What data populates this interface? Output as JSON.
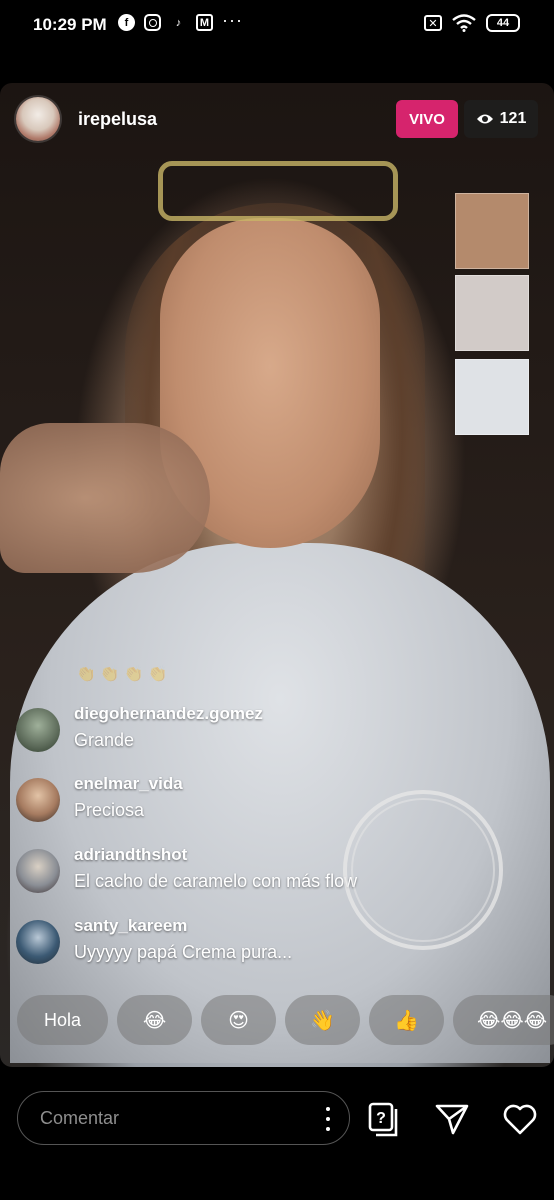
{
  "status_bar": {
    "time": "10:29 PM",
    "dots": "···",
    "battery": "44",
    "left_icons": [
      "facebook-icon",
      "instagram-icon",
      "tiktok-icon",
      "gmail-icon"
    ],
    "right_icons": [
      "dnd-icon",
      "wifi-icon",
      "battery-icon"
    ]
  },
  "live": {
    "host_username": "irepelusa",
    "live_badge": "VIVO",
    "viewer_count": "121",
    "accent_color": "#d6246d"
  },
  "swatches": [
    "#b48a6c",
    "#d2cbc8",
    "#dfe2e6"
  ],
  "comments": [
    {
      "user": "diegohernandez.gomez",
      "text": "Grande",
      "avatar_color": "#5d6b5a"
    },
    {
      "user": "enelmar_vida",
      "text": "Preciosa",
      "avatar_color": "#7a5a4a"
    },
    {
      "user": "adriandthshot",
      "text": "El cacho de caramelo con más flow",
      "avatar_color": "#8a8e95"
    },
    {
      "user": "santy_kareem",
      "text": "Uyyyyy papá Crema pura...",
      "avatar_color": "#3c5a74"
    }
  ],
  "quick_replies": [
    "Hola",
    "😂",
    "😍",
    "👋",
    "👍",
    "😂😂😂"
  ],
  "bottom": {
    "comment_placeholder": "Comentar",
    "icons": [
      "question-icon",
      "send-icon",
      "heart-icon"
    ]
  }
}
